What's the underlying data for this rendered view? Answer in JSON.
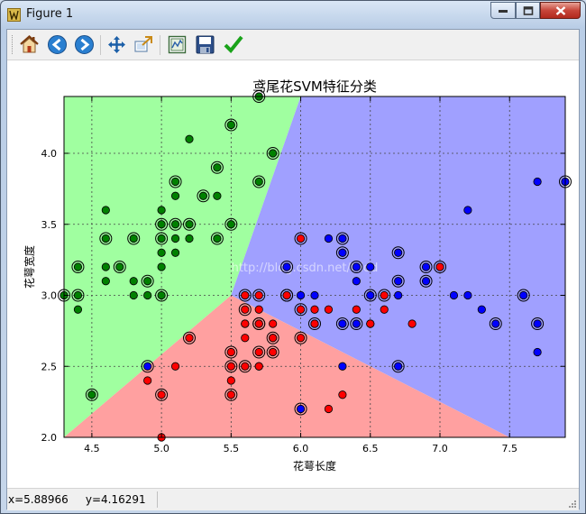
{
  "window": {
    "title": "Figure 1"
  },
  "toolbar": {
    "items": [
      "home-icon",
      "back-icon",
      "forward-icon",
      "pan-icon",
      "zoom-icon",
      "subplots-icon",
      "save-icon",
      "check-icon"
    ]
  },
  "status": {
    "coords": "x=5.88966     y=4.16291"
  },
  "watermark": {
    "text": "http://blog.csdn.net/lsldd"
  },
  "colors": {
    "class0_region": "#a0ffa0",
    "class1_region": "#a0a0ff",
    "class2_region": "#ffa0a0",
    "class0_point": "#008000",
    "class1_point": "#0000ff",
    "class2_point": "#ff0000",
    "grid": "#444444"
  },
  "chart_data": {
    "type": "scatter",
    "title": "鸢尾花SVM特征分类",
    "xlabel": "花萼长度",
    "ylabel": "花萼宽度",
    "xlim": [
      4.3,
      7.9
    ],
    "ylim": [
      2.0,
      4.4
    ],
    "xticks": [
      "4.5",
      "5.0",
      "5.5",
      "6.0",
      "6.5",
      "7.0",
      "7.5"
    ],
    "yticks": [
      "2.0",
      "2.5",
      "3.0",
      "3.5",
      "4.0"
    ],
    "grid": true,
    "decision_regions": {
      "green": [
        [
          4.3,
          4.4
        ],
        [
          6.0,
          4.4
        ],
        [
          5.5,
          3.0
        ],
        [
          4.3,
          2.0
        ]
      ],
      "blue": [
        [
          6.0,
          4.4
        ],
        [
          7.9,
          4.4
        ],
        [
          7.9,
          2.0
        ],
        [
          7.5,
          2.0
        ],
        [
          5.5,
          3.0
        ]
      ],
      "red": [
        [
          4.3,
          2.0
        ],
        [
          7.5,
          2.0
        ],
        [
          5.5,
          3.0
        ]
      ]
    },
    "series": [
      {
        "color": "green",
        "points": [
          [
            4.3,
            3.0
          ],
          [
            4.4,
            2.9
          ],
          [
            4.4,
            3.0
          ],
          [
            4.4,
            3.2
          ],
          [
            4.5,
            2.3
          ],
          [
            4.6,
            3.1
          ],
          [
            4.6,
            3.2
          ],
          [
            4.6,
            3.4
          ],
          [
            4.6,
            3.6
          ],
          [
            4.7,
            3.2
          ],
          [
            4.8,
            3.0
          ],
          [
            4.8,
            3.1
          ],
          [
            4.8,
            3.4
          ],
          [
            4.9,
            3.0
          ],
          [
            4.9,
            3.1
          ],
          [
            5.0,
            3.0
          ],
          [
            5.0,
            3.2
          ],
          [
            5.0,
            3.3
          ],
          [
            5.0,
            3.4
          ],
          [
            5.0,
            3.5
          ],
          [
            5.0,
            3.6
          ],
          [
            5.1,
            3.3
          ],
          [
            5.1,
            3.4
          ],
          [
            5.1,
            3.5
          ],
          [
            5.1,
            3.7
          ],
          [
            5.1,
            3.8
          ],
          [
            5.2,
            3.4
          ],
          [
            5.2,
            3.5
          ],
          [
            5.2,
            4.1
          ],
          [
            5.3,
            3.7
          ],
          [
            5.4,
            3.4
          ],
          [
            5.4,
            3.7
          ],
          [
            5.4,
            3.9
          ],
          [
            5.5,
            3.5
          ],
          [
            5.5,
            4.2
          ],
          [
            5.7,
            3.8
          ],
          [
            5.7,
            4.4
          ],
          [
            5.8,
            4.0
          ]
        ],
        "ringed": [
          [
            4.3,
            3.0
          ],
          [
            4.4,
            3.0
          ],
          [
            4.4,
            3.2
          ],
          [
            4.5,
            2.3
          ],
          [
            4.6,
            3.4
          ],
          [
            4.7,
            3.2
          ],
          [
            4.8,
            3.4
          ],
          [
            4.9,
            3.1
          ],
          [
            5.0,
            3.0
          ],
          [
            5.0,
            3.4
          ],
          [
            5.0,
            3.5
          ],
          [
            5.1,
            3.5
          ],
          [
            5.1,
            3.8
          ],
          [
            5.2,
            3.5
          ],
          [
            5.3,
            3.7
          ],
          [
            5.4,
            3.4
          ],
          [
            5.4,
            3.9
          ],
          [
            5.5,
            3.5
          ],
          [
            5.5,
            4.2
          ],
          [
            5.7,
            3.8
          ],
          [
            5.7,
            4.4
          ],
          [
            5.8,
            4.0
          ]
        ]
      },
      {
        "color": "blue",
        "points": [
          [
            4.9,
            2.5
          ],
          [
            5.6,
            2.8
          ],
          [
            5.6,
            3.0
          ],
          [
            5.7,
            2.5
          ],
          [
            5.7,
            2.8
          ],
          [
            5.8,
            2.7
          ],
          [
            5.9,
            3.0
          ],
          [
            5.9,
            3.2
          ],
          [
            6.0,
            2.2
          ],
          [
            6.0,
            3.0
          ],
          [
            6.1,
            2.8
          ],
          [
            6.1,
            3.0
          ],
          [
            6.2,
            3.4
          ],
          [
            6.3,
            2.5
          ],
          [
            6.3,
            2.8
          ],
          [
            6.3,
            3.3
          ],
          [
            6.3,
            3.4
          ],
          [
            6.4,
            2.8
          ],
          [
            6.4,
            3.1
          ],
          [
            6.4,
            3.2
          ],
          [
            6.5,
            2.8
          ],
          [
            6.5,
            3.0
          ],
          [
            6.5,
            3.2
          ],
          [
            6.7,
            2.5
          ],
          [
            6.7,
            3.0
          ],
          [
            6.7,
            3.1
          ],
          [
            6.7,
            3.3
          ],
          [
            6.9,
            3.1
          ],
          [
            6.9,
            3.2
          ],
          [
            7.0,
            3.2
          ],
          [
            7.1,
            3.0
          ],
          [
            7.2,
            3.0
          ],
          [
            7.2,
            3.6
          ],
          [
            7.3,
            2.9
          ],
          [
            7.4,
            2.8
          ],
          [
            7.6,
            3.0
          ],
          [
            7.7,
            2.6
          ],
          [
            7.7,
            2.8
          ],
          [
            7.7,
            3.8
          ],
          [
            7.9,
            3.8
          ]
        ],
        "ringed": [
          [
            4.9,
            2.5
          ],
          [
            5.6,
            3.0
          ],
          [
            5.7,
            2.8
          ],
          [
            5.9,
            3.0
          ],
          [
            5.9,
            3.2
          ],
          [
            6.0,
            2.2
          ],
          [
            6.3,
            2.8
          ],
          [
            6.3,
            3.3
          ],
          [
            6.3,
            3.4
          ],
          [
            6.4,
            2.8
          ],
          [
            6.4,
            3.2
          ],
          [
            6.5,
            3.0
          ],
          [
            6.7,
            2.5
          ],
          [
            6.7,
            3.1
          ],
          [
            6.7,
            3.3
          ],
          [
            6.9,
            3.1
          ],
          [
            6.9,
            3.2
          ],
          [
            7.4,
            2.8
          ],
          [
            7.6,
            3.0
          ],
          [
            7.7,
            2.8
          ],
          [
            7.9,
            3.8
          ]
        ]
      },
      {
        "color": "red",
        "points": [
          [
            4.9,
            2.4
          ],
          [
            5.0,
            2.0
          ],
          [
            5.0,
            2.3
          ],
          [
            5.1,
            2.5
          ],
          [
            5.2,
            2.7
          ],
          [
            5.5,
            2.3
          ],
          [
            5.5,
            2.4
          ],
          [
            5.5,
            2.5
          ],
          [
            5.5,
            2.6
          ],
          [
            5.6,
            2.5
          ],
          [
            5.6,
            2.7
          ],
          [
            5.6,
            2.8
          ],
          [
            5.6,
            2.9
          ],
          [
            5.6,
            3.0
          ],
          [
            5.7,
            2.5
          ],
          [
            5.7,
            2.6
          ],
          [
            5.7,
            2.8
          ],
          [
            5.7,
            2.9
          ],
          [
            5.7,
            3.0
          ],
          [
            5.8,
            2.6
          ],
          [
            5.8,
            2.7
          ],
          [
            5.8,
            2.8
          ],
          [
            5.9,
            3.0
          ],
          [
            6.0,
            2.7
          ],
          [
            6.0,
            2.9
          ],
          [
            6.0,
            3.4
          ],
          [
            6.1,
            2.8
          ],
          [
            6.1,
            2.9
          ],
          [
            6.2,
            2.2
          ],
          [
            6.2,
            2.9
          ],
          [
            6.3,
            2.3
          ],
          [
            6.4,
            2.9
          ],
          [
            6.5,
            2.8
          ],
          [
            6.6,
            2.9
          ],
          [
            6.6,
            3.0
          ],
          [
            6.8,
            2.8
          ],
          [
            7.0,
            3.2
          ]
        ],
        "ringed": [
          [
            5.0,
            2.3
          ],
          [
            5.2,
            2.7
          ],
          [
            5.5,
            2.3
          ],
          [
            5.5,
            2.5
          ],
          [
            5.5,
            2.6
          ],
          [
            5.6,
            2.5
          ],
          [
            5.6,
            2.9
          ],
          [
            5.7,
            2.6
          ],
          [
            5.7,
            2.8
          ],
          [
            5.7,
            3.0
          ],
          [
            5.8,
            2.6
          ],
          [
            5.8,
            2.7
          ],
          [
            5.9,
            3.0
          ],
          [
            6.0,
            2.7
          ],
          [
            6.0,
            2.9
          ],
          [
            6.0,
            3.4
          ],
          [
            6.1,
            2.8
          ],
          [
            6.6,
            3.0
          ],
          [
            7.0,
            3.2
          ]
        ]
      }
    ]
  }
}
